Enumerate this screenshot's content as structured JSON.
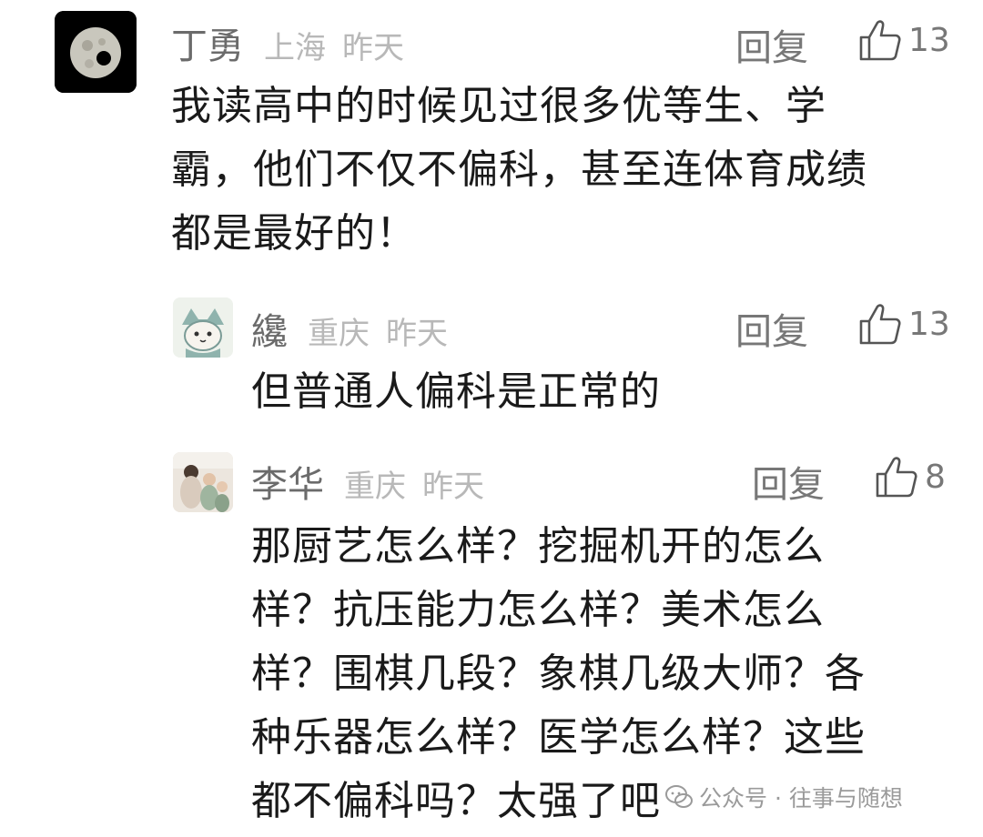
{
  "colors": {
    "name": "#6b6b6b",
    "meta": "#b8b8b8",
    "text": "#1a1a1a",
    "action": "#777777"
  },
  "comments": [
    {
      "author": "丁勇",
      "location": "上海",
      "time": "昨天",
      "reply_label": "回复",
      "likes": "13",
      "avatar_icon": "moon-avatar",
      "lines": [
        "我读高中的时候见过很多优等生、学",
        "霸，他们不仅不偏科，甚至连体育成绩",
        "都是最好的！"
      ]
    },
    {
      "author": "纔",
      "location": "重庆",
      "time": "昨天",
      "reply_label": "回复",
      "likes": "13",
      "avatar_icon": "cartoon-cat-avatar",
      "lines": [
        "但普通人偏科是正常的"
      ]
    },
    {
      "author": "李华",
      "location": "重庆",
      "time": "昨天",
      "reply_label": "回复",
      "likes": "8",
      "avatar_icon": "family-photo-avatar",
      "lines": [
        "那厨艺怎么样？挖掘机开的怎么",
        "样？抗压能力怎么样？美术怎么",
        "样？围棋几段？象棋几级大师？各",
        "种乐器怎么样？医学怎么样？这些",
        "都不偏科吗？太强了吧"
      ]
    }
  ],
  "watermark": {
    "icon": "wechat-official-account-icon",
    "text": "公众号 · 往事与随想"
  }
}
